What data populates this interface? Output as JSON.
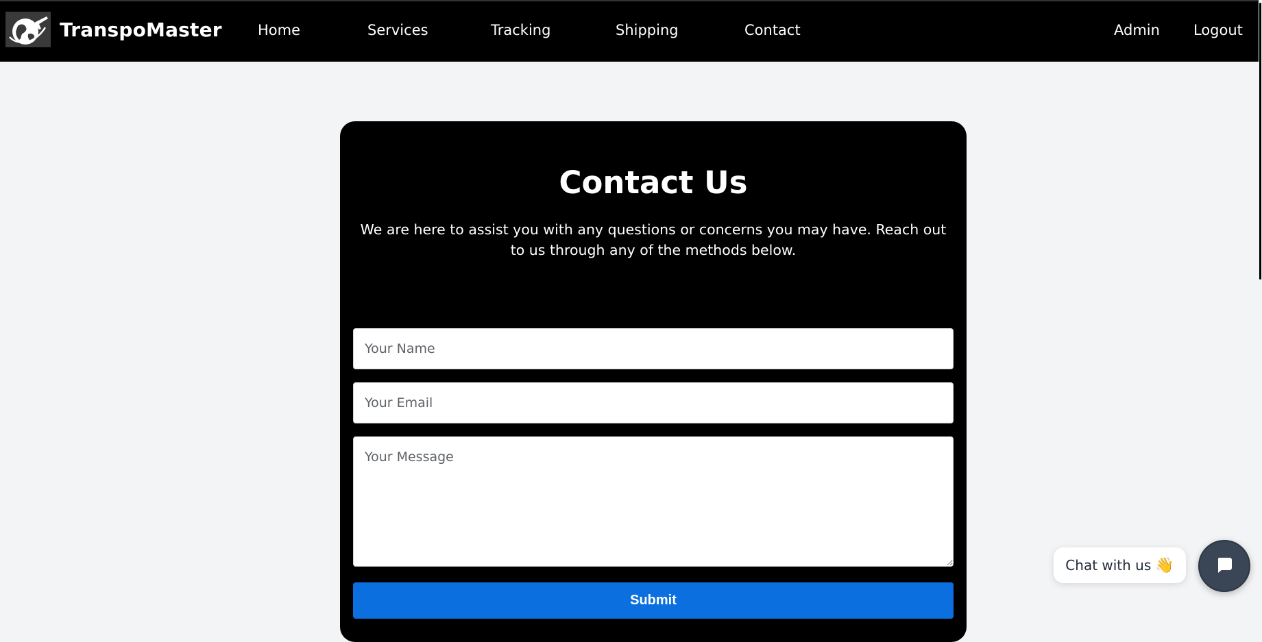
{
  "navbar": {
    "brand": "TranspoMaster",
    "links": [
      "Home",
      "Services",
      "Tracking",
      "Shipping",
      "Contact"
    ],
    "account_links": [
      "Admin",
      "Logout"
    ]
  },
  "contact": {
    "title": "Contact Us",
    "description": "We are here to assist you with any questions or concerns you may have. Reach out to us through any of the methods below.",
    "name_placeholder": "Your Name",
    "email_placeholder": "Your Email",
    "message_placeholder": "Your Message",
    "submit_label": "Submit"
  },
  "chat": {
    "prompt": "Chat with us",
    "emoji": "👋"
  },
  "colors": {
    "navbar_bg": "#000000",
    "page_bg": "#f3f4f6",
    "card_bg": "#000000",
    "submit_bg": "#0b6fe0",
    "chat_launcher_bg": "#3a4556"
  },
  "icons": {
    "brand_logo": "globe-airplane-logo",
    "chat_launcher": "chat-icon"
  }
}
